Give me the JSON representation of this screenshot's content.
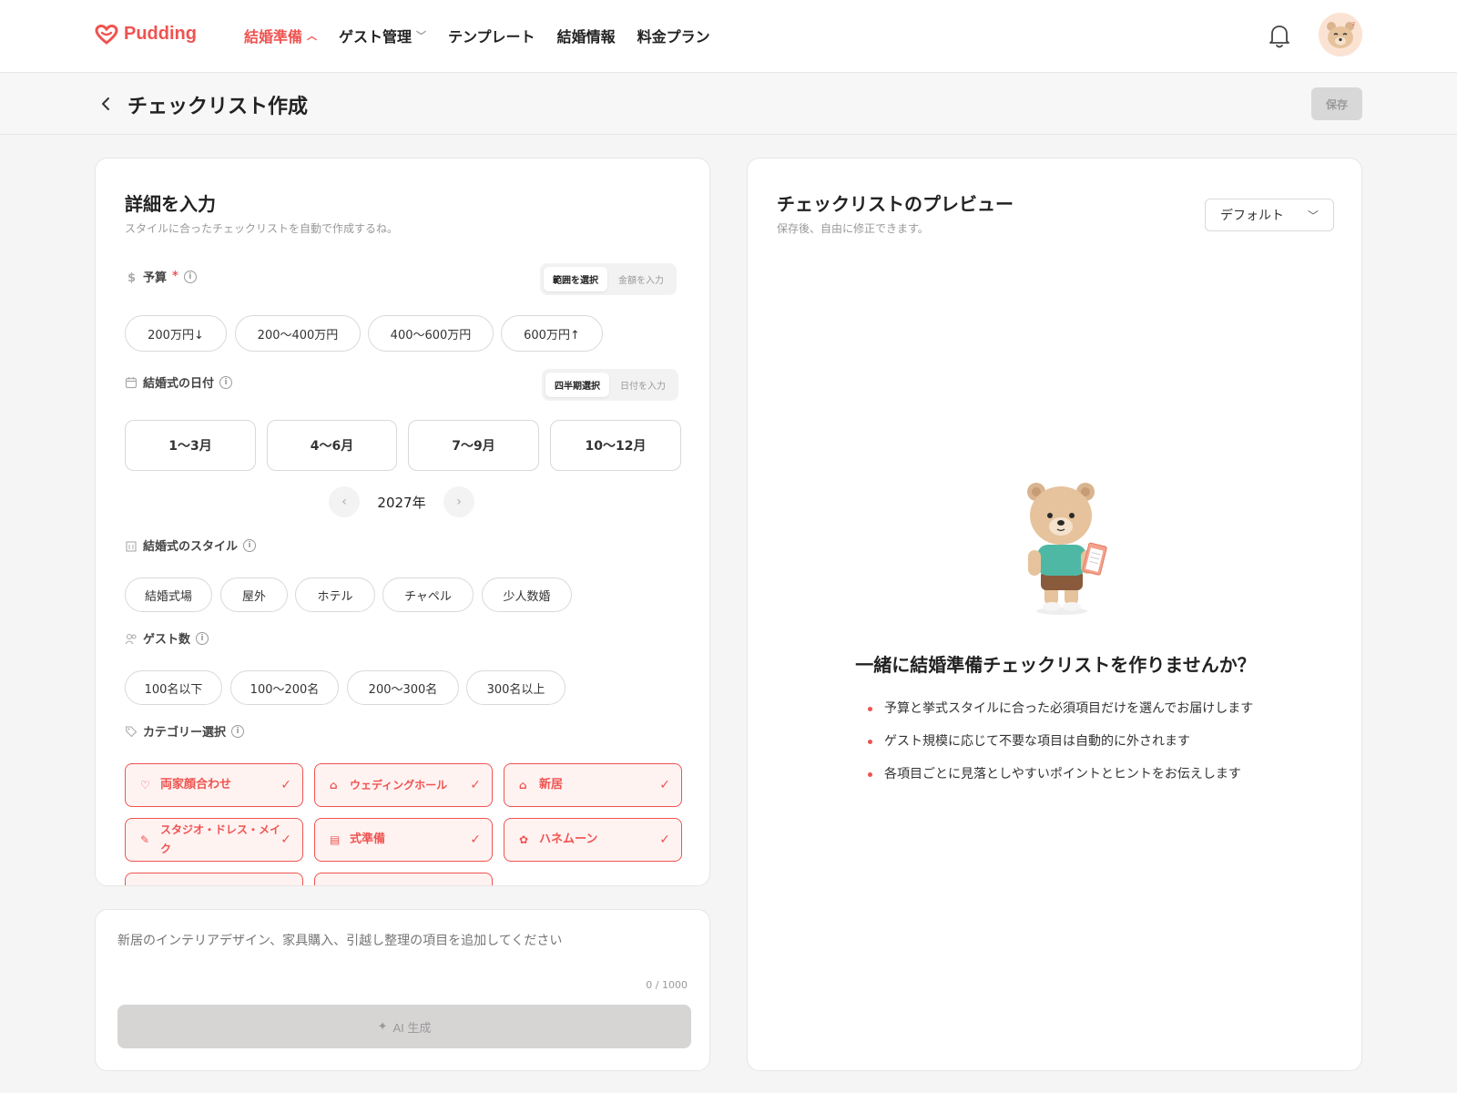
{
  "nav": {
    "brand": "Pudding",
    "menu": [
      {
        "label": "結婚準備"
      },
      {
        "label": "ゲスト管理"
      },
      {
        "label": "テンプレート"
      },
      {
        "label": "結婚情報"
      },
      {
        "label": "料金プラン"
      }
    ],
    "active_color": "#ef5350"
  },
  "header": {
    "title": "チェックリスト作成",
    "save_label": "保存"
  },
  "form": {
    "title": "詳細を入力",
    "subtitle": "スタイルに合ったチェックリストを自動で作成するね。",
    "budget": {
      "label": "予算",
      "required_mark": "*",
      "toggle": [
        "範囲を選択",
        "金額を入力"
      ],
      "options": [
        "200万円↓",
        "200〜400万円",
        "400〜600万円",
        "600万円↑"
      ]
    },
    "date": {
      "label": "結婚式の日付",
      "toggle": [
        "四半期選択",
        "日付を入力"
      ],
      "options": [
        "1〜3月",
        "4〜6月",
        "7〜9月",
        "10〜12月"
      ],
      "year": "2027年"
    },
    "style": {
      "label": "結婚式のスタイル",
      "options": [
        "結婚式場",
        "屋外",
        "ホテル",
        "チャペル",
        "少人数婚"
      ]
    },
    "guests": {
      "label": "ゲスト数",
      "options": [
        "100名以下",
        "100〜200名",
        "200〜300名",
        "300名以上"
      ]
    },
    "categories": {
      "label": "カテゴリー選択",
      "items": [
        {
          "label": "両家顔合わせ",
          "icon": "heart-hands-icon"
        },
        {
          "label": "ウェディングホール",
          "icon": "building-icon"
        },
        {
          "label": "新居",
          "icon": "home-icon"
        },
        {
          "label": "スタジオ・ドレス・メイク",
          "icon": "brush-icon"
        },
        {
          "label": "式準備",
          "icon": "clipboard-icon"
        },
        {
          "label": "ハネムーン",
          "icon": "ribbon-icon"
        }
      ]
    }
  },
  "prompt": {
    "placeholder": "新居のインテリアデザイン、家具購入、引越し整理の項目を追加してください",
    "counter": "0 / 1000",
    "ai_label": "AI 生成"
  },
  "preview": {
    "title": "チェックリストのプレビュー",
    "subtitle": "保存後、自由に修正できます。",
    "select_value": "デフォルト",
    "empty_title": "一緒に結婚準備チェックリストを作りませんか？",
    "bullets": [
      "予算と挙式スタイルに合った必須項目だけを選んでお届けします",
      "ゲスト規模に応じて不要な項目は自動的に外されます",
      "各項目ごとに見落としやすいポイントとヒントをお伝えします"
    ]
  }
}
